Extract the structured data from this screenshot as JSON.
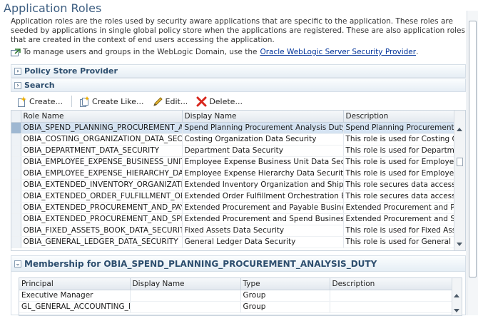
{
  "page": {
    "title": "Application Roles",
    "description": "Application roles are the roles used by security aware applications that are specific to the application. These roles are seeded by applications in single global policy store when the applications are registered. These are also application roles that are created in the context of end users accessing the application.",
    "manage_text": "To manage users and groups in the WebLogic Domain, use the",
    "manage_link": "Oracle WebLogic Server Security Provider",
    "manage_period": "."
  },
  "panels": {
    "policy_store": "Policy Store Provider",
    "search": "Search"
  },
  "toolbar": {
    "create": "Create...",
    "create_like": "Create Like...",
    "edit": "Edit...",
    "delete": "Delete..."
  },
  "roles_table": {
    "columns": [
      "Role Name",
      "Display Name",
      "Description"
    ],
    "rows": [
      [
        "OBIA_SPEND_PLANNING_PROCUREMENT_ANALYSIS_DUTY",
        "Spend Planning Procurement Analysis Duty",
        "Spend Planning Procurement Analysis Duty"
      ],
      [
        "OBIA_COSTING_ORGANIZATION_DATA_SECURITY",
        "Costing Organization Data Security",
        "This role is used for Costing Organization Data Security"
      ],
      [
        "OBIA_DEPARTMENT_DATA_SECURITY",
        "Department Data Security",
        "This role is used for Department Data Security"
      ],
      [
        "OBIA_EMPLOYEE_EXPENSE_BUSINESS_UNIT_DATA_SECURITY",
        "Employee Expense Business Unit Data Security",
        "This role is used for Employee Expense Business Unit"
      ],
      [
        "OBIA_EMPLOYEE_EXPENSE_HIERARCHY_DATA_SECURITY",
        "Employee Expense Hierarchy Data Security",
        "This role is used for Employee Expense Hierarchy"
      ],
      [
        "OBIA_EXTENDED_INVENTORY_ORGANIZATION_DATA_SECURITY",
        "Extended Inventory Organization and Shipment Data Security",
        "This role secures data access by Inventory Organization"
      ],
      [
        "OBIA_EXTENDED_ORDER_FULFILLMENT_ORCHESTRATION",
        "Extended Order Fulfillment Orchestration Business Unit",
        "This role secures data access by Business Unit"
      ],
      [
        "OBIA_EXTENDED_PROCUREMENT_AND_PAYABLES",
        "Extended Procurement and Payable Business Unit",
        "Extended Procurement and Payables"
      ],
      [
        "OBIA_EXTENDED_PROCUREMENT_AND_SPEND",
        "Extended Procurement and Spend Business Unit",
        "Extended Procurement and Spend"
      ],
      [
        "OBIA_FIXED_ASSETS_BOOK_DATA_SECURITY",
        "Fixed Assets Data Security",
        "This role is used for Fixed Assets Book Data Security"
      ],
      [
        "OBIA_GENERAL_LEDGER_DATA_SECURITY",
        "General Ledger Data Security",
        "This role is used for General Ledger Data Security"
      ]
    ]
  },
  "membership": {
    "title": "Membership for OBIA_SPEND_PLANNING_PROCUREMENT_ANALYSIS_DUTY",
    "columns": [
      "Principal",
      "Display Name",
      "Type",
      "Description"
    ],
    "rows": [
      [
        "Executive Manager",
        "",
        "Group",
        ""
      ],
      [
        "GL_GENERAL_ACCOUNTING_MANAGER",
        "",
        "Group",
        ""
      ]
    ]
  },
  "colors": {
    "title": "#3c5d80",
    "link": "#003399",
    "selected_row": "#d5e3f2",
    "panel_header_text": "#2d4e6e"
  }
}
